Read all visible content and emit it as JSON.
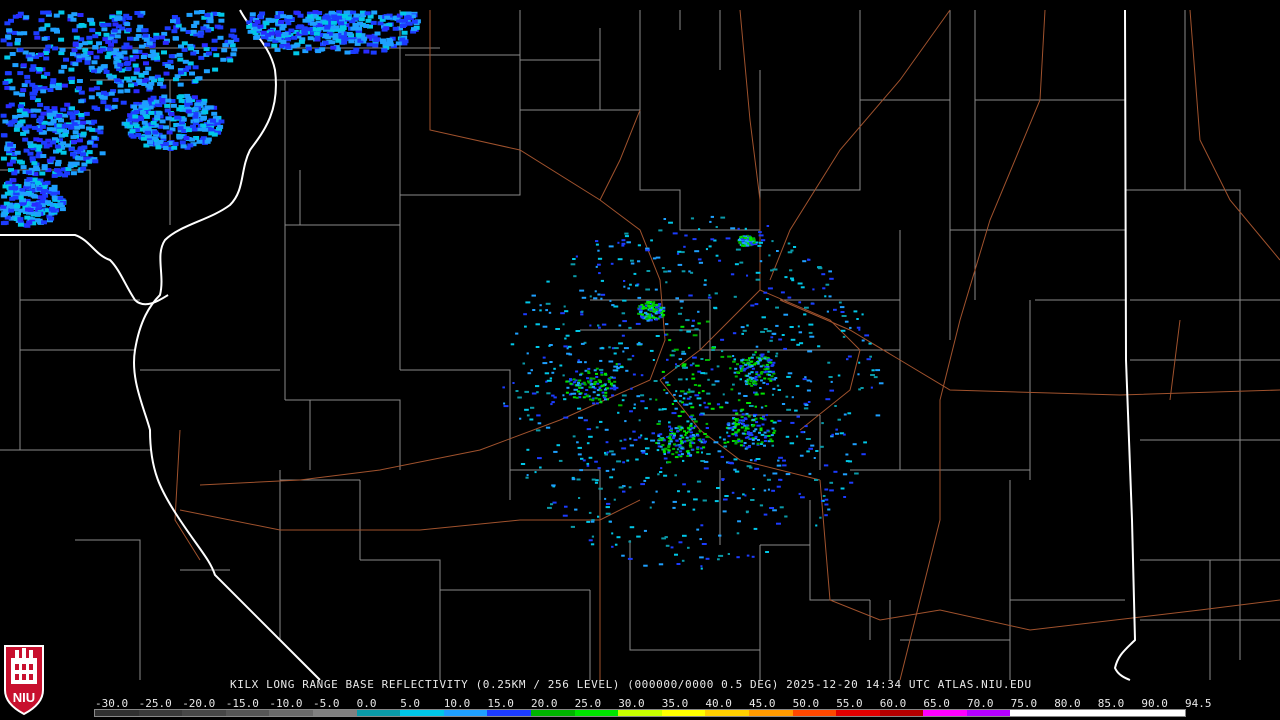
{
  "caption": "KILX LONG RANGE BASE REFLECTIVITY (0.25KM / 256 LEVEL) (000000/0000 0.5 DEG) 2025-12-20 14:34 UTC  ATLAS.NIU.EDU",
  "scale_labels": [
    "-30.0",
    "-25.0",
    "-20.0",
    "-15.0",
    "-10.0",
    "-5.0",
    "0.0",
    "5.0",
    "10.0",
    "15.0",
    "20.0",
    "25.0",
    "30.0",
    "35.0",
    "40.0",
    "45.0",
    "50.0",
    "55.0",
    "60.0",
    "65.0",
    "70.0",
    "75.0",
    "80.0",
    "85.0",
    "90.0",
    "94.5"
  ],
  "scale_colors": [
    "#303030",
    "#3a3a3a",
    "#474747",
    "#565656",
    "#6a6a6a",
    "#808080",
    "#0a9aa8",
    "#00c8e8",
    "#1ea0ff",
    "#1c3cff",
    "#00b400",
    "#00e400",
    "#c8ff00",
    "#ffff00",
    "#ffd000",
    "#ff9a00",
    "#ff4800",
    "#e00000",
    "#b40000",
    "#ff00ff",
    "#b400ff",
    "#ffffff",
    "#ffffff",
    "#ffffff",
    "#ffffff"
  ],
  "logo_text": "NIU",
  "colors": {
    "state_border": "#ffffff",
    "county_border": "#8a8a8a",
    "highway": "#a0522d",
    "background": "#000000"
  }
}
